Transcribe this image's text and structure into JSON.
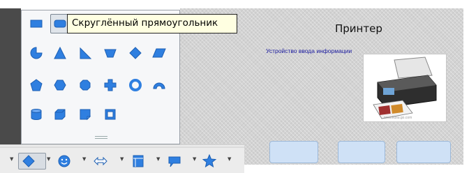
{
  "tooltip": {
    "text": "Скруглённый прямоугольник"
  },
  "slide": {
    "title": "Принтер",
    "subtitle": "Устройство ввода информации",
    "photo_caption": "www.kusu.go.com"
  },
  "shapes_panel": {
    "rows": [
      [
        "rectangle",
        "rounded-rectangle"
      ],
      [
        "pie",
        "triangle",
        "right-triangle",
        "trapezoid",
        "diamond",
        "parallelogram"
      ],
      [
        "pentagon",
        "hexagon",
        "octagon",
        "plus",
        "donut",
        "block-arc"
      ],
      [
        "cylinder",
        "cube",
        "folded-corner",
        "frame"
      ]
    ],
    "selected": "rounded-rectangle"
  },
  "toolbar": {
    "items": [
      "basic-shapes",
      "symbol-shapes",
      "block-arrows",
      "flowchart",
      "callouts",
      "stars"
    ],
    "active": "basic-shapes"
  },
  "colors": {
    "shape_fill": "#2f7fe0",
    "shape_stroke": "#1d5fb3",
    "tooltip_bg": "#ffffe1"
  }
}
